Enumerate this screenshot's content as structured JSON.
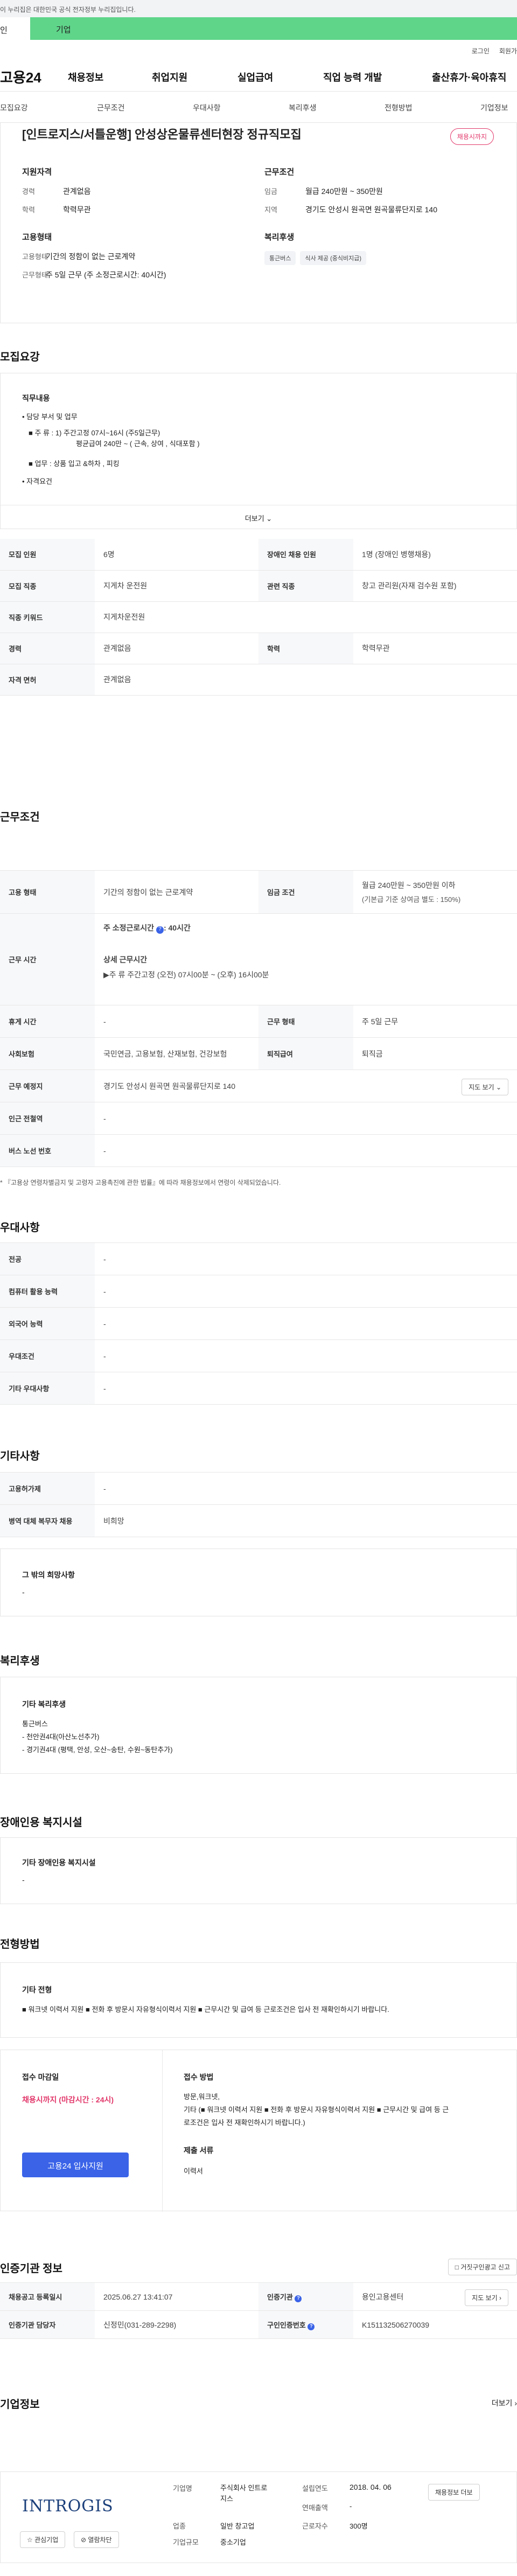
{
  "gov_notice": "이 누리집은 대한민국 공식 전자정부 누리집입니다.",
  "tabs": {
    "left": "인",
    "corp": "기업"
  },
  "top_links": {
    "login": "로그인",
    "join": "회원가"
  },
  "logo": "고용24",
  "gnb": [
    "채용정보",
    "취업지원",
    "실업급여",
    "직업 능력 개발",
    "출산휴가·육아휴직"
  ],
  "subnav": [
    "모집요강",
    "근무조건",
    "우대사항",
    "복리후생",
    "전형방법",
    "기업정보"
  ],
  "job": {
    "title": "[인트로지스/서틀운행] 안성상온물류센터현장 정규직모집",
    "badge": "채용시까지",
    "qual_title": "지원자격",
    "career_k": "경력",
    "career_v": "관계없음",
    "edu_k": "학력",
    "edu_v": "학력무관",
    "emp_title": "고용형태",
    "emp_k": "고용형태",
    "emp_v": "기간의 정함이 없는 근로계약",
    "worktype_k": "근무형태",
    "worktype_v": "주 5일 근무 (주 소정근로시간: 40시간)",
    "cond_title": "근무조건",
    "wage_k": "임금",
    "wage_v": "월급 240만원 ~ 350만원",
    "region_k": "지역",
    "region_v": "경기도 안성시 원곡면 원곡물류단지로 140",
    "welfare_title": "복리후생",
    "welfare_chips": [
      "통근버스",
      "식사 제공 (중식비지급)"
    ]
  },
  "recruit": {
    "title": "모집요강",
    "duty_title": "직무내용",
    "b1": "• 담당 부서 및 업무",
    "b2": "■ 주 류 : 1) 주간고정  07시~16시 (주5일근무)",
    "b3": "평균급여  240만 ~ ( 근속, 상여 , 식대포함 )",
    "b4": "■ 업무 : 상품 입고 &하차 , 피킹",
    "b5": "• 자격요건",
    "more": "더보기",
    "rows": [
      {
        "k1": "모집 인원",
        "v1": "6명",
        "k2": "장애인 채용 인원",
        "v2": "1명 (장애인 병행채용)"
      },
      {
        "k1": "모집 직종",
        "v1": "지게차 운전원",
        "k2": "관련 직종",
        "v2": "창고 관리원(자재 검수원 포함)"
      },
      {
        "k1": "직종 키워드",
        "v1": "지게차운전원",
        "k2": "",
        "v2": ""
      },
      {
        "k1": "경력",
        "v1": "관계없음",
        "k2": "학력",
        "v2": "학력무관"
      },
      {
        "k1": "자격 면허",
        "v1": "관계없음",
        "k2": "",
        "v2": ""
      }
    ]
  },
  "work": {
    "title": "근무조건",
    "emp_k": "고용 형태",
    "emp_v": "기간의 정함이 없는 근로계약",
    "wage_k": "임금 조건",
    "wage_v1": "월급 240만원 ~ 350만원 이하",
    "wage_v2": "(기본급 기준 상여금 별도 : 150%)",
    "hours_k": "근무 시간",
    "hours_weekly": "주 소정근로시간",
    "hours_weekly_v": ": 40시간",
    "hours_detail_title": "상세 근무시간",
    "hours_detail": "▶주 류     주간고정 (오전) 07시00분 ~ (오후) 16시00분",
    "rest_k": "휴게 시간",
    "rest_v": "-",
    "shape_k": "근무 형태",
    "shape_v": "주 5일 근무",
    "ins_k": "사회보험",
    "ins_v": "국민연금, 고용보험, 산재보험, 건강보험",
    "retire_k": "퇴직급여",
    "retire_v": "퇴직금",
    "place_k": "근무 예정지",
    "place_v": "경기도 안성시 원곡면 원곡물류단지로 140",
    "map_btn": "지도 보기",
    "subway_k": "인근 전철역",
    "subway_v": "-",
    "bus_k": "버스 노선 번호",
    "bus_v": "-",
    "note": "* 『고용상 연령차별금지 및 고령자 고용촉진에 관한 법률』에 따라 채용정보에서 연령이 삭제되었습니다."
  },
  "pref": {
    "title": "우대사항",
    "rows": [
      {
        "k": "전공",
        "v": "-"
      },
      {
        "k": "컴퓨터 활용 능력",
        "v": "-"
      },
      {
        "k": "외국어 능력",
        "v": "-"
      },
      {
        "k": "우대조건",
        "v": "-"
      },
      {
        "k": "기타 우대사항",
        "v": "-"
      }
    ]
  },
  "etc": {
    "title": "기타사항",
    "rows": [
      {
        "k": "고용허가제",
        "v": "-"
      },
      {
        "k": "병역 대체 복무자 채용",
        "v": "비희망"
      }
    ],
    "hope_title": "그 밖의 희망사항",
    "hope_v": "-"
  },
  "welfare": {
    "title": "복리후생",
    "box_title": "기타 복리후생",
    "l1": "통근버스",
    "l2": "- 천안권4대(아산노선추가)",
    "l3": "- 경기권4대 (평택, 안성, 오산~송탄, 수원~동탄추가)"
  },
  "disabled": {
    "title": "장애인용 복지시설",
    "box_title": "기타 장애인용 복지시설",
    "v": "-"
  },
  "select": {
    "title": "전형방법",
    "box_title": "기타 전형",
    "text": "■ 워크넷 이력서 지원 ■ 전화 후 방문시 자유형식이력서 지원 ■ 근무시간 및 급여 등 근로조건은 입사 전 재확인하시기 바랍니다.",
    "deadline_title": "접수 마감일",
    "deadline_v": "채용시까지 (마감시간 : 24시)",
    "apply_btn": "고용24 입사지원",
    "method_title": "접수 방법",
    "method_l1": "방문,워크넷,",
    "method_l2": "기타 (■ 워크넷 이력서 지원 ■ 전화 후 방문시 자유형식이력서 지원 ■ 근무시간 및 급여 등 근",
    "method_l3": "로조건은 입사 전 재확인하시기 바랍니다.)",
    "docs_title": "제출 서류",
    "docs_v": "이력서"
  },
  "agency": {
    "title": "인증기관 정보",
    "report_btn": "거짓구인광고 신고",
    "reg_k": "채용공고 등록일시",
    "reg_v": "2025.06.27 13:41:07",
    "org_k": "인증기관",
    "org_v": "용인고용센터",
    "mgr_k": "인증기관 담당자",
    "mgr_v": "신정민(031-289-2298)",
    "no_k": "구인인증번호",
    "no_v": "K151132506270039",
    "map_btn": "지도 보기"
  },
  "company": {
    "title": "기업정보",
    "more": "더보기",
    "logo": "INTROGIS",
    "interest_btn": "관심기업",
    "block_btn": "열람차단",
    "name_k": "기업명",
    "name_v1": "주식회사 인트로",
    "name_v2": "지스",
    "ind_k": "업종",
    "ind_v": "일반 창고업",
    "size_k": "기업규모",
    "size_v": "중소기업",
    "est_k": "설립연도",
    "est_v": "2018. 04. 06",
    "sales_k": "연매출액",
    "sales_v": "-",
    "emp_k": "근로자수",
    "emp_v": "300명",
    "more_btn": "채용정보 더보"
  },
  "colors": {
    "accent_green": "#5fd58a",
    "badge_pink": "#e2386b",
    "deadline_red": "#e2386b",
    "apply_blue": "#3a63e8"
  }
}
